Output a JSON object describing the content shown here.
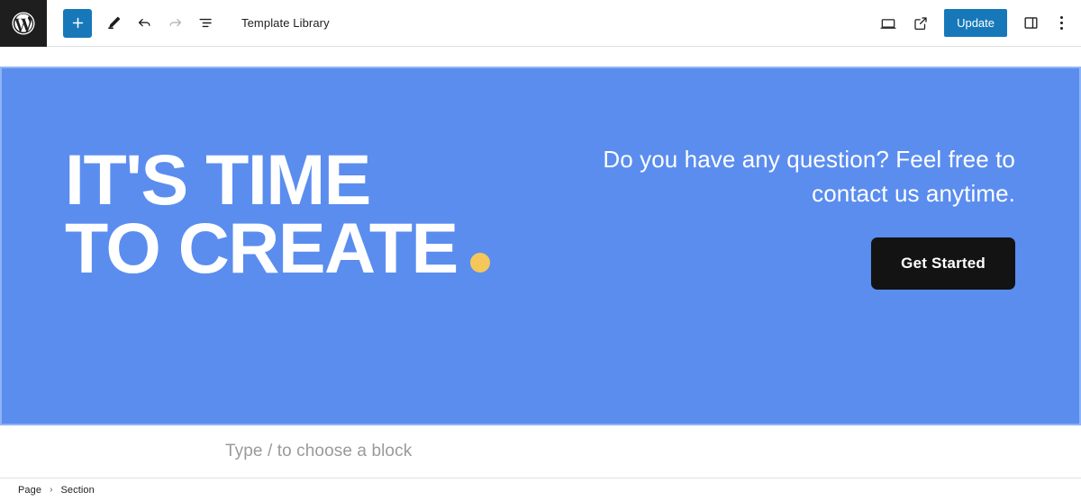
{
  "header": {
    "logo_icon": "wordpress-logo-icon",
    "title": "Template Library",
    "tools": [
      {
        "name": "add-block-button",
        "icon": "plus-icon",
        "label": "Add block",
        "disabled": false
      },
      {
        "name": "edit-tool-button",
        "icon": "pencil-icon",
        "label": "Tools",
        "disabled": false
      },
      {
        "name": "undo-button",
        "icon": "undo-arrow-icon",
        "label": "Undo",
        "disabled": false
      },
      {
        "name": "redo-button",
        "icon": "redo-arrow-icon",
        "label": "Redo",
        "disabled": true
      },
      {
        "name": "list-view-button",
        "icon": "list-view-icon",
        "label": "Document Overview",
        "disabled": false
      }
    ],
    "right_tools": [
      {
        "name": "view-device-button",
        "icon": "desktop-icon",
        "label": "View"
      },
      {
        "name": "preview-external-button",
        "icon": "external-link-icon",
        "label": "Preview in new tab"
      },
      {
        "name": "settings-sidebar-toggle",
        "icon": "sidebar-panel-icon",
        "label": "Settings"
      },
      {
        "name": "options-menu-button",
        "icon": "kebab-menu-icon",
        "label": "Options"
      }
    ],
    "update_label": "Update",
    "accent_color": "#1778b9"
  },
  "canvas": {
    "hero": {
      "background_color": "#5b8def",
      "selection_outline_color": "#8fb4f5",
      "heading_line1": "IT'S TIME",
      "heading_line2": "TO CREATE",
      "heading_dot_color": "#f5c75a",
      "paragraph": "Do you have any question? Feel free to contact us anytime.",
      "cta_label": "Get Started",
      "cta_background": "#131313",
      "cta_text_color": "#ffffff"
    },
    "appender_placeholder": "Type / to choose a block"
  },
  "breadcrumb": {
    "items": [
      {
        "label": "Page"
      },
      {
        "label": "Section"
      }
    ],
    "separator": "›"
  }
}
